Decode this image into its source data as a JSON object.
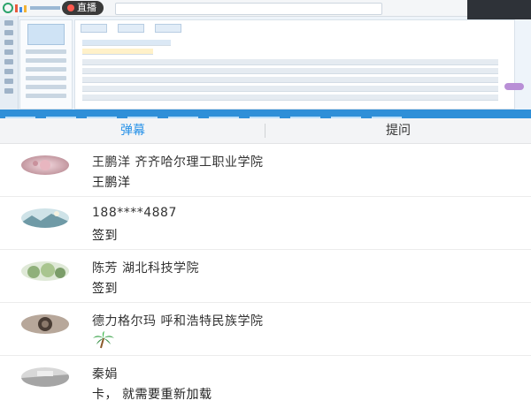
{
  "video": {
    "live_label": "直播"
  },
  "tabs": [
    {
      "label": "弹幕",
      "active": true
    },
    {
      "label": "提问",
      "active": false
    }
  ],
  "colors": {
    "accent": "#2a93e8",
    "tab_bar": "#f3f4f6",
    "live_dot": "#ff5a4f"
  },
  "messages": [
    {
      "name": "王鹏洋 齐齐哈尔理工职业学院",
      "text": "王鹏洋"
    },
    {
      "name": "188****4887",
      "text": "签到"
    },
    {
      "name": "陈芳 湖北科技学院",
      "text": "签到"
    },
    {
      "name": "德力格尔玛 呼和浩特民族学院",
      "text": "",
      "emoji": "palm-tree-icon"
    },
    {
      "name": "秦娟",
      "text": "卡， 就需要重新加载"
    }
  ]
}
